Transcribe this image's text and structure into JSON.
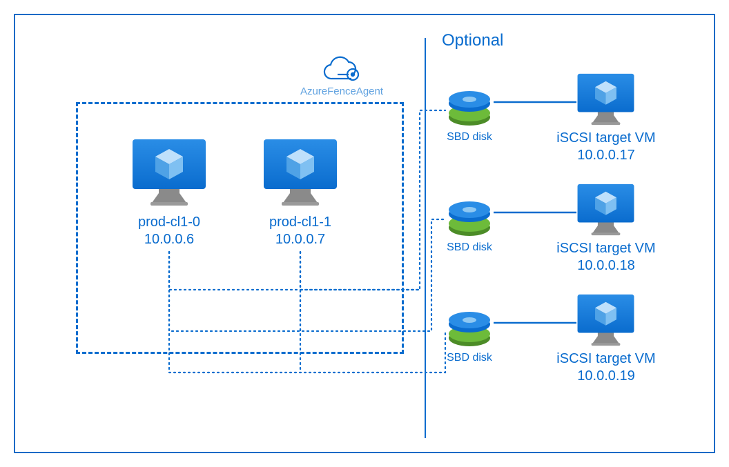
{
  "colors": {
    "azure_blue": "#0A6CCE",
    "light_blue": "#60A2E0",
    "green_disk": "#5FB030",
    "green_dark": "#4C8C27"
  },
  "header": {
    "optional_title": "Optional",
    "fence_agent_label": "AzureFenceAgent"
  },
  "cluster_nodes": [
    {
      "name": "prod-cl1-0",
      "ip": "10.0.0.6"
    },
    {
      "name": "prod-cl1-1",
      "ip": "10.0.0.7"
    }
  ],
  "sbd_disk_label": "SBD disk",
  "iscsi_targets": [
    {
      "label_line1": "iSCSI target VM",
      "ip": "10.0.0.17"
    },
    {
      "label_line1": "iSCSI target VM",
      "ip": "10.0.0.18"
    },
    {
      "label_line1": "iSCSI target VM",
      "ip": "10.0.0.19"
    }
  ],
  "chart_data": {
    "type": "diagram",
    "title": "Pacemaker cluster with Azure Fence Agent and optional SBD over iSCSI",
    "nodes": [
      {
        "id": "prod-cl1-0",
        "type": "vm",
        "ip": "10.0.0.6",
        "group": "cluster"
      },
      {
        "id": "prod-cl1-1",
        "type": "vm",
        "ip": "10.0.0.7",
        "group": "cluster"
      },
      {
        "id": "AzureFenceAgent",
        "type": "cloud-agent",
        "group": "cluster"
      },
      {
        "id": "sbd-disk-1",
        "type": "disk",
        "group": "optional"
      },
      {
        "id": "sbd-disk-2",
        "type": "disk",
        "group": "optional"
      },
      {
        "id": "sbd-disk-3",
        "type": "disk",
        "group": "optional"
      },
      {
        "id": "iscsi-vm-1",
        "type": "vm",
        "ip": "10.0.0.17",
        "group": "optional"
      },
      {
        "id": "iscsi-vm-2",
        "type": "vm",
        "ip": "10.0.0.18",
        "group": "optional"
      },
      {
        "id": "iscsi-vm-3",
        "type": "vm",
        "ip": "10.0.0.19",
        "group": "optional"
      }
    ],
    "edges": [
      {
        "from": "prod-cl1-0",
        "to": "sbd-disk-1",
        "style": "dotted"
      },
      {
        "from": "prod-cl1-1",
        "to": "sbd-disk-1",
        "style": "dotted"
      },
      {
        "from": "prod-cl1-0",
        "to": "sbd-disk-2",
        "style": "dotted"
      },
      {
        "from": "prod-cl1-1",
        "to": "sbd-disk-2",
        "style": "dotted"
      },
      {
        "from": "prod-cl1-0",
        "to": "sbd-disk-3",
        "style": "dotted"
      },
      {
        "from": "prod-cl1-1",
        "to": "sbd-disk-3",
        "style": "dotted"
      },
      {
        "from": "sbd-disk-1",
        "to": "iscsi-vm-1",
        "style": "solid"
      },
      {
        "from": "sbd-disk-2",
        "to": "iscsi-vm-2",
        "style": "solid"
      },
      {
        "from": "sbd-disk-3",
        "to": "iscsi-vm-3",
        "style": "solid"
      }
    ]
  }
}
